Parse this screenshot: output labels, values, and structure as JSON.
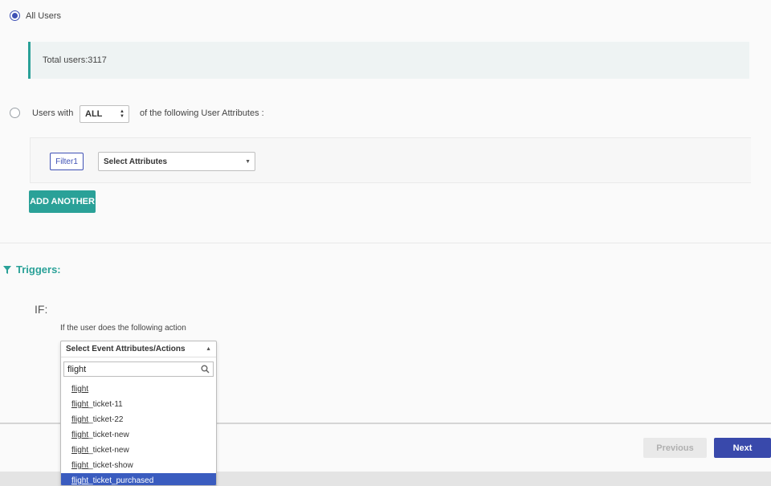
{
  "audience": {
    "all_users_label": "All Users",
    "total_users_text": "Total users:3117",
    "users_with_label": "Users with",
    "match_select_value": "ALL",
    "attributes_suffix": "of the following User Attributes :",
    "filter_tag": "Filter1",
    "attribute_select_value": "Select Attributes",
    "add_another_label": "ADD ANOTHER"
  },
  "triggers": {
    "title": "Triggers:",
    "if_label": "IF:",
    "action_prompt": "If the user does the following action",
    "event_select_placeholder": "Select Event Attributes/Actions",
    "search_value": "flight",
    "options": [
      {
        "match": "flight",
        "rest": ""
      },
      {
        "match": "flight",
        "rest": "_ticket-11"
      },
      {
        "match": "flight",
        "rest": "_ticket-22"
      },
      {
        "match": "flight",
        "rest": "_ticket-new"
      },
      {
        "match": "flight",
        "rest": "_ticket-new"
      },
      {
        "match": "flight",
        "rest": "_ticket-show"
      },
      {
        "match": "flight",
        "rest": "_ticket_purchased"
      }
    ]
  },
  "footer": {
    "previous_label": "Previous",
    "next_label": "Next"
  },
  "colors": {
    "accent_teal": "#2aa198",
    "primary_blue": "#3949ab",
    "selected_option": "#3a5cbf"
  },
  "icons": {
    "filter": "funnel-icon",
    "search": "search-icon",
    "dropdown_caret": "caret-icon"
  }
}
